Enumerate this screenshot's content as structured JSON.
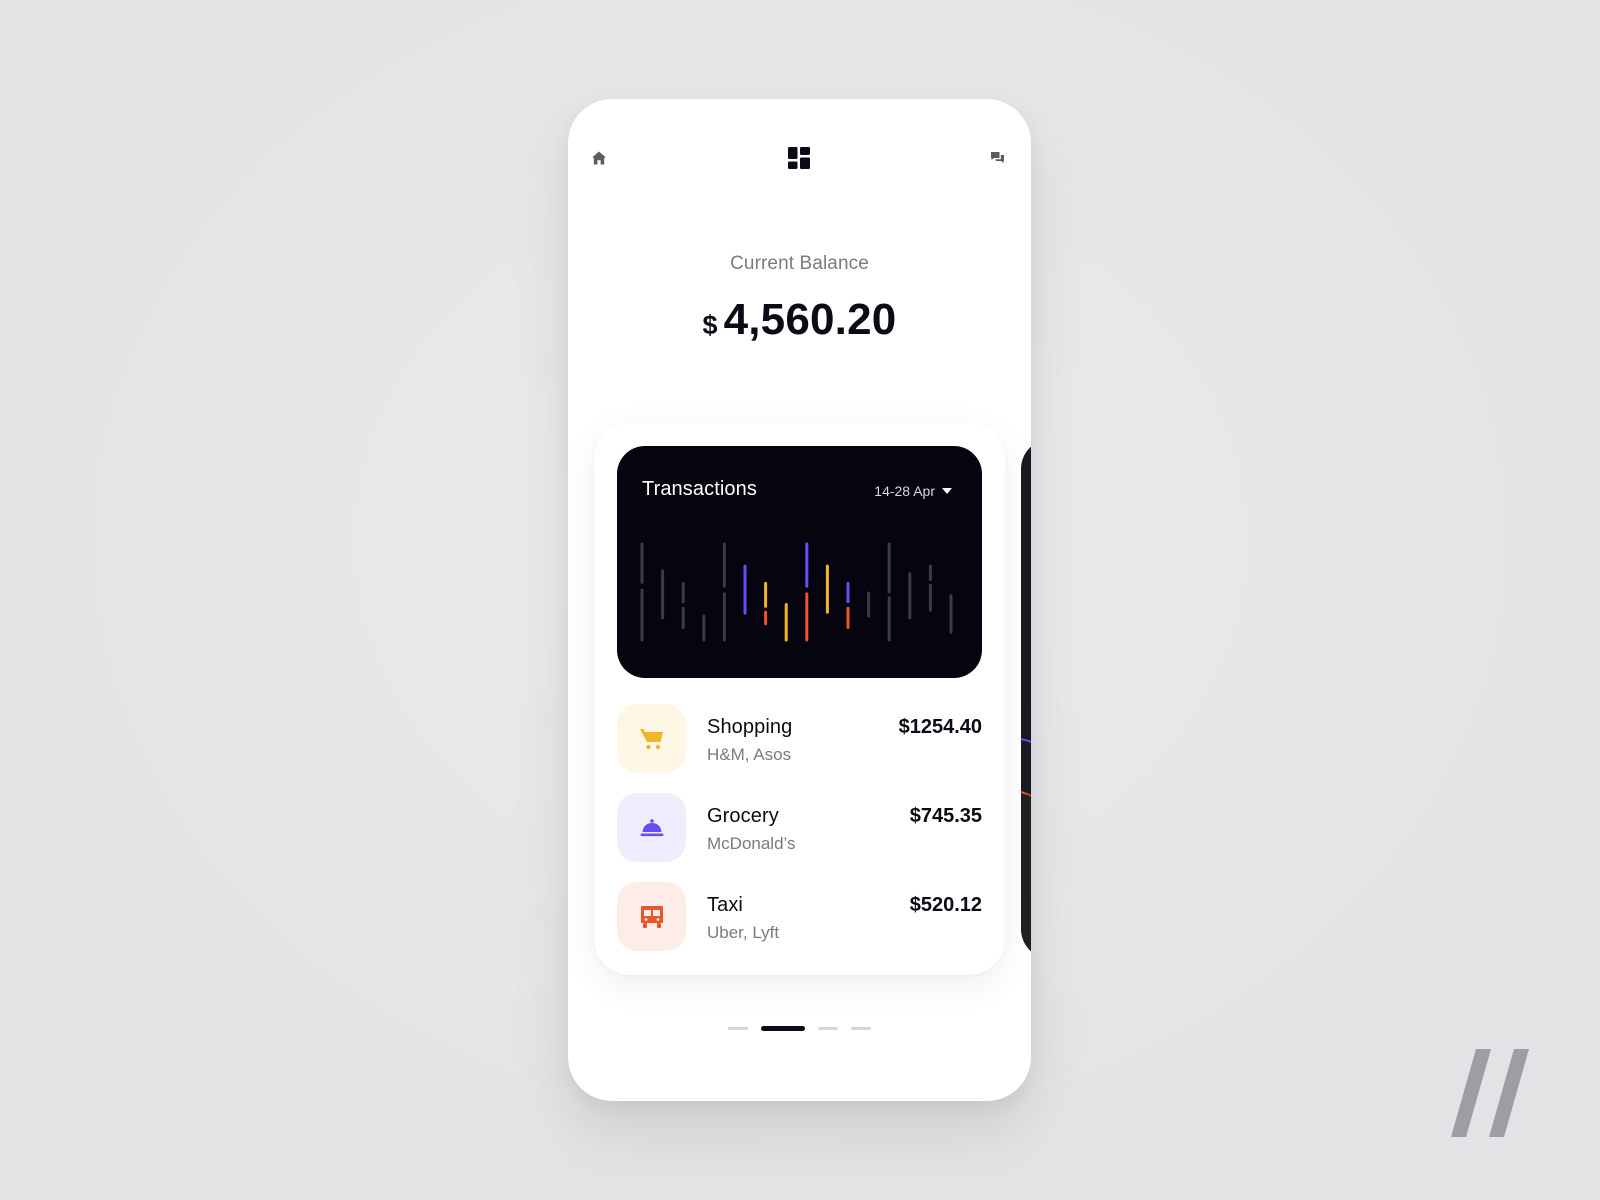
{
  "nav": {
    "home_icon": "home-icon",
    "dashboard_icon": "dashboard-grid-icon",
    "chat_icon": "chat-bubbles-icon"
  },
  "balance": {
    "label": "Current Balance",
    "currency": "$",
    "amount": "4,560.20"
  },
  "transactions_card": {
    "title": "Transactions",
    "date_range": "14-28 Apr"
  },
  "transactions": [
    {
      "name": "Shopping",
      "merchants": "H&M, Asos",
      "amount": "$1254.40",
      "icon": "shopping-cart-icon",
      "icon_color": "#f2b42a",
      "icon_bg": "#fef7e6"
    },
    {
      "name": "Grocery",
      "merchants": "McDonald’s",
      "amount": "$745.35",
      "icon": "food-cloche-icon",
      "icon_color": "#6a4cf5",
      "icon_bg": "#efedfd"
    },
    {
      "name": "Taxi",
      "merchants": "Uber, Lyft",
      "amount": "$520.12",
      "icon": "bus-icon",
      "icon_color": "#e8562a",
      "icon_bg": "#fdece7"
    }
  ],
  "colors": {
    "background": "#e6e6e8",
    "card_dark": "#05040f",
    "text_primary": "#0b0b16",
    "text_secondary": "#7b7b80",
    "bar_neutral": "#3a3a4e",
    "bar_shopping": "#f2b42a",
    "bar_grocery": "#6a4cf5",
    "bar_taxi": "#e8562a"
  },
  "chart_data": {
    "type": "bar",
    "title": "Transactions",
    "grid": false,
    "series_colors": {
      "neutral": "#3a3a4e",
      "shopping": "#f2b42a",
      "grocery": "#6a4cf5",
      "taxi": "#e8562a"
    },
    "columns": [
      [
        {
          "c": "neutral",
          "from": 0.0,
          "to": 0.4
        },
        {
          "c": "neutral",
          "from": 0.48,
          "to": 1.0
        }
      ],
      [
        {
          "c": "neutral",
          "from": 0.28,
          "to": 0.77
        }
      ],
      [
        {
          "c": "neutral",
          "from": 0.41,
          "to": 0.6
        },
        {
          "c": "neutral",
          "from": 0.67,
          "to": 0.87
        }
      ],
      [
        {
          "c": "neutral",
          "from": 0.75,
          "to": 1.0
        }
      ],
      [
        {
          "c": "neutral",
          "from": 0.0,
          "to": 0.44
        },
        {
          "c": "neutral",
          "from": 0.52,
          "to": 1.0
        }
      ],
      [
        {
          "c": "grocery",
          "from": 0.23,
          "to": 0.72
        }
      ],
      [
        {
          "c": "shopping",
          "from": 0.41,
          "to": 0.65
        },
        {
          "c": "taxi",
          "from": 0.71,
          "to": 0.83
        }
      ],
      [
        {
          "c": "shopping",
          "from": 0.63,
          "to": 1.0
        }
      ],
      [
        {
          "c": "grocery",
          "from": 0.0,
          "to": 0.44
        },
        {
          "c": "taxi",
          "from": 0.52,
          "to": 1.0
        }
      ],
      [
        {
          "c": "shopping",
          "from": 0.23,
          "to": 0.71
        }
      ],
      [
        {
          "c": "grocery",
          "from": 0.41,
          "to": 0.6
        },
        {
          "c": "taxi",
          "from": 0.67,
          "to": 0.87
        }
      ],
      [
        {
          "c": "neutral",
          "from": 0.51,
          "to": 0.75
        }
      ],
      [
        {
          "c": "neutral",
          "from": 0.0,
          "to": 0.5
        },
        {
          "c": "neutral",
          "from": 0.56,
          "to": 1.0
        }
      ],
      [
        {
          "c": "neutral",
          "from": 0.31,
          "to": 0.77
        }
      ],
      [
        {
          "c": "neutral",
          "from": 0.23,
          "to": 0.37
        },
        {
          "c": "neutral",
          "from": 0.43,
          "to": 0.69
        }
      ],
      [
        {
          "c": "neutral",
          "from": 0.54,
          "to": 0.92
        }
      ]
    ]
  },
  "pager": {
    "count": 4,
    "active_index": 1
  },
  "brand": {
    "logo": "double-slash-logo"
  }
}
